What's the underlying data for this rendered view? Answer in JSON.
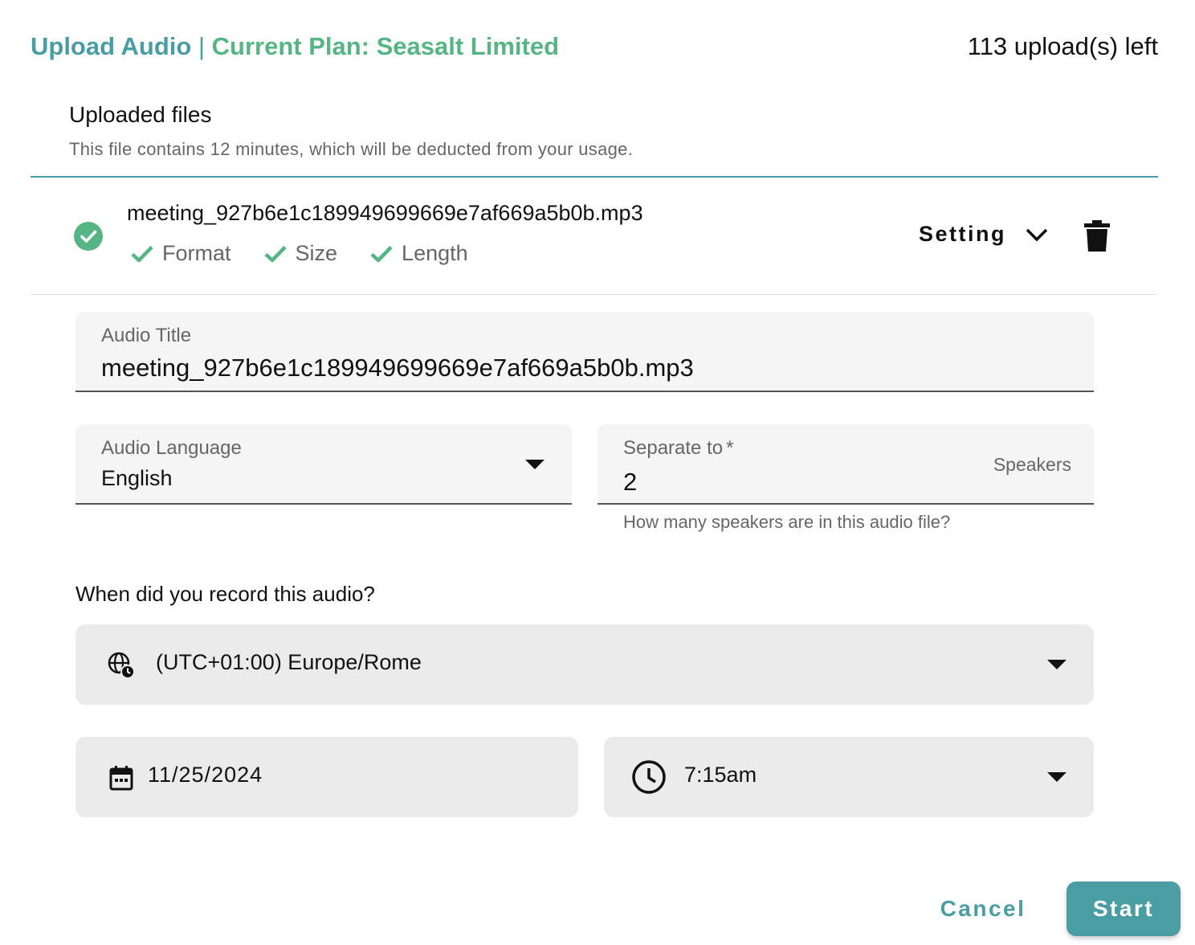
{
  "header": {
    "title": "Upload Audio",
    "separator": "|",
    "plan": "Current Plan: Seasalt Limited",
    "uploads_left": "113 upload(s) left"
  },
  "uploaded": {
    "title": "Uploaded files",
    "subtitle": "This file contains 12 minutes, which will be deducted from your usage."
  },
  "file": {
    "name": "meeting_927b6e1c189949699669e7af669a5b0b.mp3",
    "checks": [
      "Format",
      "Size",
      "Length"
    ],
    "setting_label": "Setting",
    "status_icon": "check-circle-icon",
    "delete_icon": "trash-icon"
  },
  "form": {
    "audio_title_label": "Audio Title",
    "audio_title_value": "meeting_927b6e1c189949699669e7af669a5b0b.mp3",
    "language_label": "Audio Language",
    "language_value": "English",
    "separate_label": "Separate to",
    "separate_required": "*",
    "separate_value": "2",
    "separate_suffix": "Speakers",
    "separate_helper": "How many speakers are in this audio file?",
    "record_question": "When did you record this audio?",
    "timezone_value": "(UTC+01:00) Europe/Rome",
    "date_value": "11/25/2024",
    "time_value": "7:15am"
  },
  "actions": {
    "cancel": "Cancel",
    "start": "Start"
  },
  "colors": {
    "teal": "#4a9ea3",
    "green": "#55b683"
  }
}
